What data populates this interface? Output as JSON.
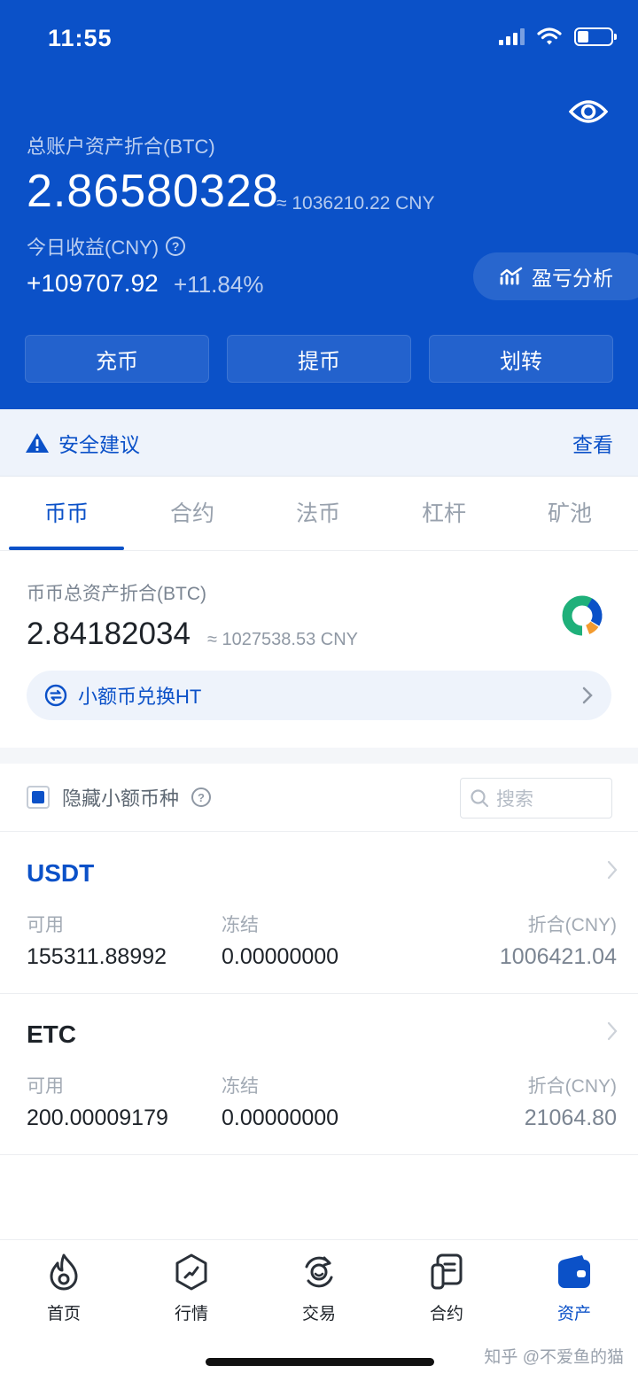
{
  "status": {
    "time": "11:55"
  },
  "header": {
    "total_label": "总账户资产折合(BTC)",
    "total_value": "2.86580328",
    "total_cny": "≈ 1036210.22 CNY",
    "today_label": "今日收益(CNY)",
    "today_value": "+109707.92",
    "today_pct": "+11.84%",
    "pnl_button": "盈亏分析",
    "actions": [
      "充币",
      "提币",
      "划转"
    ]
  },
  "security": {
    "label": "安全建议",
    "link": "查看"
  },
  "tabs": [
    {
      "label": "币币",
      "active": true
    },
    {
      "label": "合约",
      "active": false
    },
    {
      "label": "法币",
      "active": false
    },
    {
      "label": "杠杆",
      "active": false
    },
    {
      "label": "矿池",
      "active": false
    }
  ],
  "spot": {
    "label": "币币总资产折合(BTC)",
    "value": "2.84182034",
    "cny": "≈ 1027538.53 CNY",
    "convert_label": "小额币兑换HT"
  },
  "filter": {
    "hide_small_label": "隐藏小额币种",
    "hide_small_checked": true,
    "search_placeholder": "搜索"
  },
  "coins": [
    {
      "name": "USDT",
      "highlight": true,
      "available_label": "可用",
      "available": "155311.88992",
      "frozen_label": "冻结",
      "frozen": "0.00000000",
      "value_label": "折合(CNY)",
      "value": "1006421.04"
    },
    {
      "name": "ETC",
      "highlight": false,
      "available_label": "可用",
      "available": "200.00009179",
      "frozen_label": "冻结",
      "frozen": "0.00000000",
      "value_label": "折合(CNY)",
      "value": "21064.80"
    }
  ],
  "nav": [
    {
      "label": "首页",
      "icon": "flame-icon",
      "active": false
    },
    {
      "label": "行情",
      "icon": "market-icon",
      "active": false
    },
    {
      "label": "交易",
      "icon": "trade-icon",
      "active": false
    },
    {
      "label": "合约",
      "icon": "contract-icon",
      "active": false
    },
    {
      "label": "资产",
      "icon": "wallet-icon",
      "active": true
    }
  ],
  "watermark": "知乎 @不爱鱼的猫",
  "colors": {
    "primary": "#0b51c8",
    "usdt": "#0b51c8"
  }
}
